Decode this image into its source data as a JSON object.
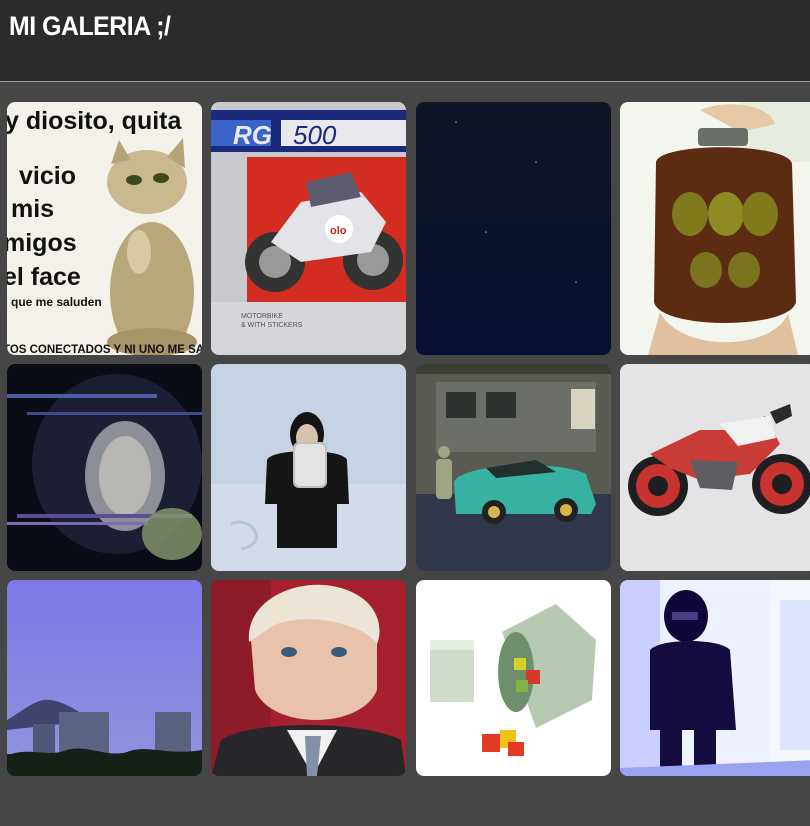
{
  "header": {
    "title": "MI GALERIA ;/"
  },
  "gallery": {
    "tiles": [
      {
        "id": "meme-cat",
        "lines": [
          "y diosito, quita",
          "vicio",
          "mis",
          "migos",
          "el face",
          "s que me saluden",
          "TOS CONECTADOS Y NI UNO ME SAL"
        ]
      },
      {
        "id": "moto-box",
        "lines": [
          "RG",
          "500",
          "MOTORBIKE",
          "& WITH STICKERS"
        ],
        "stamp": "olo"
      },
      {
        "id": "night-sky",
        "lines": []
      },
      {
        "id": "green-jar",
        "lines": []
      },
      {
        "id": "glitch-face",
        "lines": []
      },
      {
        "id": "snow-sign",
        "lines": []
      },
      {
        "id": "teal-car",
        "lines": []
      },
      {
        "id": "red-motorcycle",
        "lines": []
      },
      {
        "id": "purple-skyline",
        "lines": []
      },
      {
        "id": "older-man",
        "lines": []
      },
      {
        "id": "pixel-can",
        "lines": []
      },
      {
        "id": "blue-hallway",
        "lines": []
      }
    ]
  },
  "colors": {
    "background": "#464646",
    "header": "#2b2b2b",
    "title": "#ffffff"
  }
}
